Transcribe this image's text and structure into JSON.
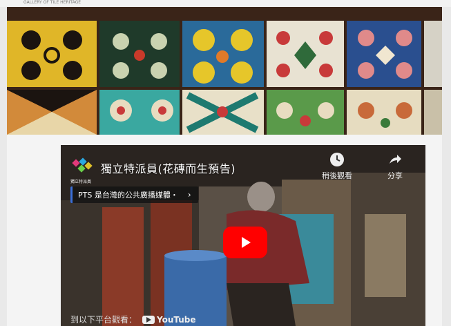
{
  "page": {
    "tiny_header": "GALLERY OF TILE HERITAGE"
  },
  "video": {
    "channel_logo_text": "獨立特派員",
    "title": "獨立特派員(花磚而生預告)",
    "watch_later_label": "稍後觀看",
    "share_label": "分享",
    "pts_banner": "PTS 是台灣的公共廣播媒體・",
    "bottom_text": "到以下平台觀看：",
    "youtube_label": "YouTube"
  },
  "colors": {
    "play_button": "#ff0000",
    "pts_accent": "#3b6fd8"
  }
}
